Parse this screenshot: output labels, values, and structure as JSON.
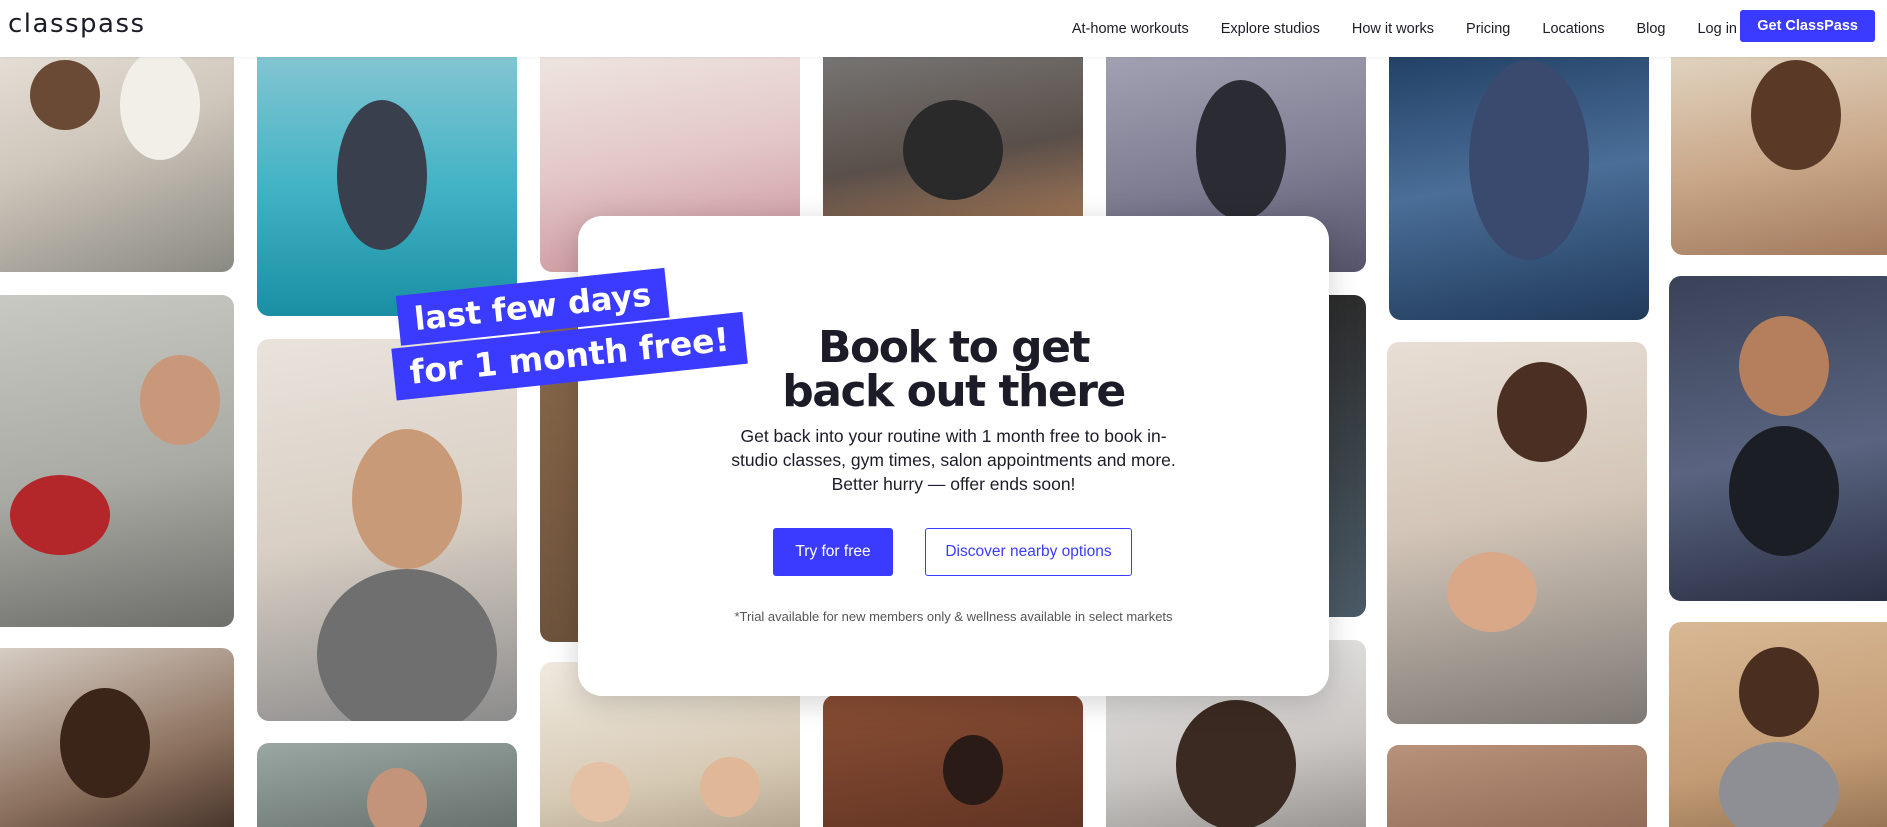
{
  "header": {
    "logo_text": "classpass",
    "nav": [
      {
        "label": "At-home workouts"
      },
      {
        "label": "Explore studios"
      },
      {
        "label": "How it works"
      },
      {
        "label": "Pricing"
      },
      {
        "label": "Locations"
      },
      {
        "label": "Blog"
      },
      {
        "label": "Log in"
      }
    ],
    "cta_label": "Get ClassPass"
  },
  "promo": {
    "line1": "last few days",
    "line2": "for 1 month free!"
  },
  "hero": {
    "headline_line1": "Book to get",
    "headline_line2": "back out there",
    "subtext": "Get back into your routine with 1 month free to book in-studio classes, gym times, salon appointments and more. Better hurry — offer ends soon!",
    "primary_button": "Try for free",
    "secondary_button": "Discover nearby options",
    "disclaimer": "*Trial available for new members only & wellness available in select markets"
  },
  "colors": {
    "accent": "#3b3bff",
    "text": "#1c1c28",
    "background": "#ffffff"
  }
}
